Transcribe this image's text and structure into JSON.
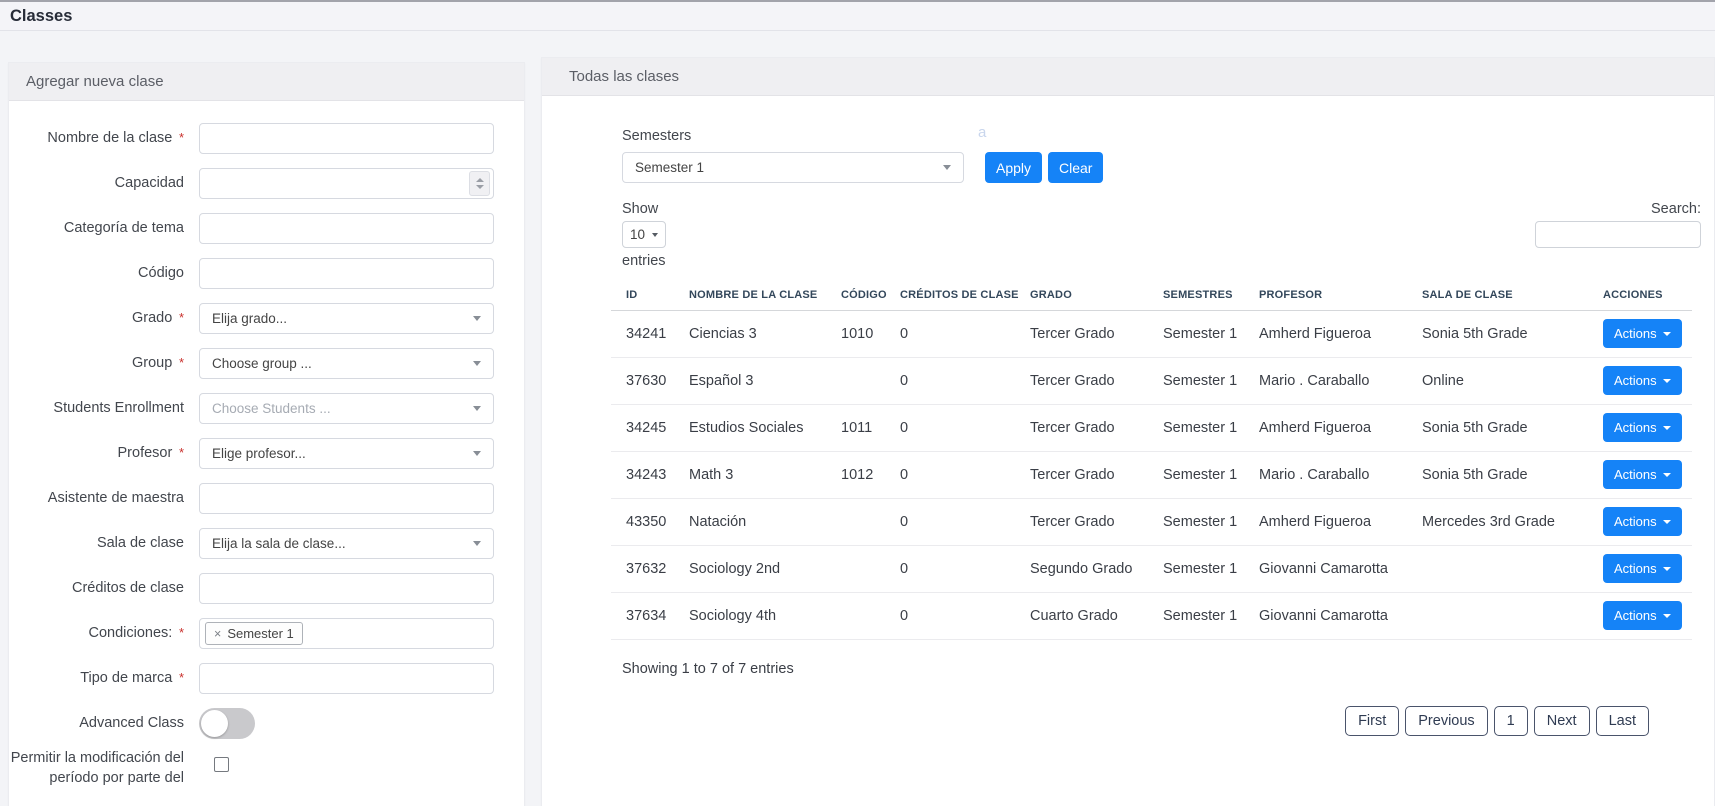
{
  "page": {
    "title": "Classes"
  },
  "colors": {
    "primary": "#1583f7",
    "table_header_text": "#33475b"
  },
  "add_class_panel": {
    "title": "Agregar nueva clase",
    "required_marker": "*",
    "fields": [
      {
        "key": "class_name",
        "label": "Nombre de la clase",
        "required": true,
        "control": "text",
        "value": ""
      },
      {
        "key": "capacity",
        "label": "Capacidad",
        "required": false,
        "control": "number",
        "value": ""
      },
      {
        "key": "subject_category",
        "label": "Categoría de tema",
        "required": false,
        "control": "text",
        "value": ""
      },
      {
        "key": "code",
        "label": "Código",
        "required": false,
        "control": "text",
        "value": ""
      },
      {
        "key": "grade",
        "label": "Grado",
        "required": true,
        "control": "select",
        "value": "Elija grado...",
        "muted": false
      },
      {
        "key": "group",
        "label": "Group",
        "required": true,
        "control": "select",
        "value": "Choose group ...",
        "muted": false
      },
      {
        "key": "students_enrollment",
        "label": "Students Enrollment",
        "required": false,
        "control": "select",
        "value": "Choose Students ...",
        "muted": true
      },
      {
        "key": "teacher",
        "label": "Profesor",
        "required": true,
        "control": "select",
        "value": "Elige profesor...",
        "muted": false
      },
      {
        "key": "teacher_assistant",
        "label": "Asistente de maestra",
        "required": false,
        "control": "text",
        "value": ""
      },
      {
        "key": "classroom",
        "label": "Sala de clase",
        "required": false,
        "control": "select",
        "value": "Elija la sala de clase...",
        "muted": false
      },
      {
        "key": "class_credits",
        "label": "Créditos de clase",
        "required": false,
        "control": "text",
        "value": ""
      },
      {
        "key": "conditions",
        "label": "Condiciones:",
        "required": true,
        "control": "tags",
        "tags": [
          {
            "remove": "×",
            "text": "Semester 1"
          }
        ]
      },
      {
        "key": "mark_type",
        "label": "Tipo de marca",
        "required": true,
        "control": "text",
        "value": ""
      },
      {
        "key": "advanced_class",
        "label": "Advanced Class",
        "required": false,
        "control": "toggle",
        "state": "off"
      },
      {
        "key": "allow_period_modification",
        "label": "Permitir la modificación del período por parte del",
        "required": false,
        "control": "checkbox",
        "checked": false
      }
    ]
  },
  "classes_panel": {
    "title": "Todas las clases",
    "semester_filter": {
      "label": "Semesters",
      "selected": "Semester 1",
      "apply_label": "Apply",
      "clear_label": "Clear",
      "stray_text": "a"
    },
    "length_control": {
      "show_label": "Show",
      "selected": "10",
      "entries_label": "entries"
    },
    "search": {
      "label": "Search:",
      "value": ""
    },
    "table": {
      "columns": [
        "ID",
        "NOMBRE DE LA CLASE",
        "CÓDIGO",
        "CRÉDITOS DE CLASE",
        "GRADO",
        "SEMESTRES",
        "PROFESOR",
        "SALA DE CLASE",
        "ACCIONES"
      ],
      "actions_button_label": "Actions",
      "rows": [
        {
          "id": "34241",
          "name": "Ciencias 3",
          "code": "1010",
          "credits": "0",
          "grade": "Tercer Grado",
          "semester": "Semester 1",
          "teacher": "Amherd Figueroa",
          "room": "Sonia 5th Grade"
        },
        {
          "id": "37630",
          "name": "Español 3",
          "code": "",
          "credits": "0",
          "grade": "Tercer Grado",
          "semester": "Semester 1",
          "teacher": "Mario . Caraballo",
          "room": "Online"
        },
        {
          "id": "34245",
          "name": "Estudios Sociales",
          "code": "1011",
          "credits": "0",
          "grade": "Tercer Grado",
          "semester": "Semester 1",
          "teacher": "Amherd Figueroa",
          "room": "Sonia 5th Grade"
        },
        {
          "id": "34243",
          "name": "Math 3",
          "code": "1012",
          "credits": "0",
          "grade": "Tercer Grado",
          "semester": "Semester 1",
          "teacher": "Mario . Caraballo",
          "room": "Sonia 5th Grade"
        },
        {
          "id": "43350",
          "name": "Natación",
          "code": "",
          "credits": "0",
          "grade": "Tercer Grado",
          "semester": "Semester 1",
          "teacher": "Amherd Figueroa",
          "room": "Mercedes 3rd Grade"
        },
        {
          "id": "37632",
          "name": "Sociology 2nd",
          "code": "",
          "credits": "0",
          "grade": "Segundo Grado",
          "semester": "Semester 1",
          "teacher": "Giovanni Camarotta",
          "room": ""
        },
        {
          "id": "37634",
          "name": "Sociology 4th",
          "code": "",
          "credits": "0",
          "grade": "Cuarto Grado",
          "semester": "Semester 1",
          "teacher": "Giovanni Camarotta",
          "room": ""
        }
      ]
    },
    "summary": "Showing 1 to 7 of 7 entries",
    "pagination": {
      "buttons": [
        "First",
        "Previous",
        "1",
        "Next",
        "Last"
      ],
      "active_page": "1"
    }
  }
}
